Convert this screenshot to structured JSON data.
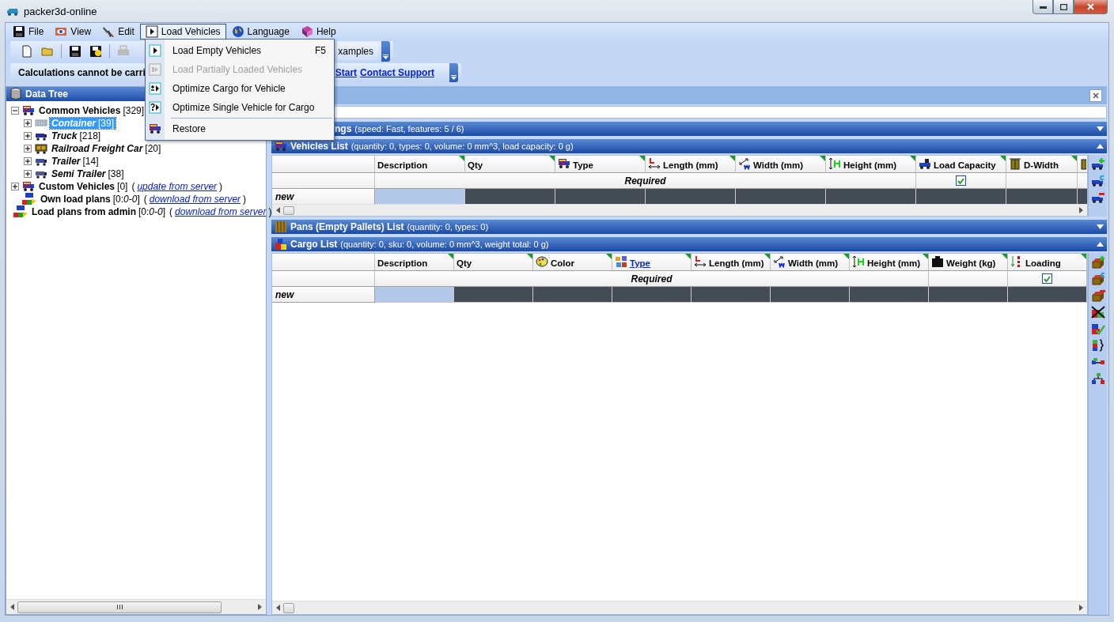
{
  "window": {
    "title": "packer3d-online"
  },
  "menu_bar": [
    {
      "label": "File",
      "selected": false
    },
    {
      "label": "View",
      "selected": false
    },
    {
      "label": "Edit",
      "selected": false
    },
    {
      "label": "Load Vehicles",
      "selected": true
    },
    {
      "label": "Language",
      "selected": false
    },
    {
      "label": "Help",
      "selected": false
    }
  ],
  "dropdown_menu": [
    {
      "kind": "item",
      "label": "Load Empty Vehicles",
      "shortcut": "F5",
      "disabled": false
    },
    {
      "kind": "item",
      "label": "Load Partially Loaded Vehicles",
      "disabled": true
    },
    {
      "kind": "item",
      "label": "Optimize Cargo for Vehicle",
      "disabled": false
    },
    {
      "kind": "item",
      "label": "Optimize Single Vehicle for Cargo",
      "disabled": false
    },
    {
      "kind": "separator"
    },
    {
      "kind": "item",
      "label": "Restore",
      "disabled": false
    }
  ],
  "toolbar": {
    "tab_label": "xamples"
  },
  "notice_bar": {
    "message": "Calculations cannot be carri",
    "links": [
      "Start",
      "Contact Support"
    ]
  },
  "data_tree": {
    "title": "Data Tree",
    "nodes": [
      {
        "label": "Common Vehicles",
        "count": "[329]",
        "expanded": true,
        "selected": false,
        "children": [
          {
            "label": "Container",
            "count": "[39]",
            "expanded": false,
            "selected": true
          },
          {
            "label": "Truck",
            "count": "[218]",
            "expanded": false,
            "selected": false
          },
          {
            "label": "Railroad Freight Car",
            "count": "[20]",
            "expanded": false,
            "selected": false
          },
          {
            "label": "Trailer",
            "count": "[14]",
            "expanded": false,
            "selected": false
          },
          {
            "label": "Semi Trailer",
            "count": "[38]",
            "expanded": false,
            "selected": false
          }
        ]
      },
      {
        "label": "Custom Vehicles",
        "count": "[0]",
        "link": "update from server",
        "link_brackets": [
          "(",
          ")"
        ],
        "expanded": false,
        "selected": false
      },
      {
        "label": "Own load plans",
        "count": "[0:*0-0*]",
        "link": "download from server",
        "link_brackets": [
          "(",
          ")"
        ],
        "selected": false
      },
      {
        "label": "Load plans from admin",
        "count": "[0:*0-0*]",
        "link": "download from server",
        "link_brackets": [
          "(",
          ")"
        ],
        "selected": false
      }
    ]
  },
  "settings_bar": {
    "title": "ngs",
    "details": "(speed: Fast, features: 5 / 6)",
    "expanded": false
  },
  "vehicles_list": {
    "title": "Vehicles List",
    "details": "(quantity: 0, types: 0, volume: 0 mm^3, load capacity: 0 g)",
    "expanded": true,
    "columns": [
      {
        "label": "Description",
        "kind": "required"
      },
      {
        "label": "Qty",
        "kind": "required"
      },
      {
        "label": "Type",
        "kind": "required"
      },
      {
        "label": "Length (mm)",
        "kind": "required"
      },
      {
        "label": "Width (mm)",
        "kind": "required"
      },
      {
        "label": "Height (mm)",
        "kind": "required"
      },
      {
        "label": "Load Capacity",
        "kind": "check",
        "checked": true
      },
      {
        "label": "D-Width",
        "kind": "plain"
      },
      {
        "kind": "plain"
      }
    ],
    "required_label": "Required",
    "new_row": {
      "label": "new",
      "cells": [
        {
          "selected": true
        },
        {
          "selected": false
        },
        {
          "selected": false
        },
        {
          "selected": false
        },
        {
          "selected": false
        },
        {
          "selected": false
        },
        {
          "selected": false
        },
        {
          "selected": false
        },
        {
          "selected": false
        }
      ]
    }
  },
  "pans_list": {
    "title": "Pans (Empty Pallets) List",
    "details": "(quantity: 0, types: 0)",
    "expanded": false
  },
  "cargo_list": {
    "title": "Cargo List",
    "details": "(quantity: 0, sku: 0, volume: 0 mm^3, weight total: 0 g)",
    "expanded": true,
    "columns": [
      {
        "label": "Description",
        "kind": "required"
      },
      {
        "label": "Qty",
        "kind": "required"
      },
      {
        "label": "Color",
        "kind": "required"
      },
      {
        "label": "Type",
        "kind": "required",
        "link": true
      },
      {
        "label": "Length (mm)",
        "kind": "required"
      },
      {
        "label": "Width (mm)",
        "kind": "required"
      },
      {
        "label": "Height (mm)",
        "kind": "required"
      },
      {
        "label": "Weight (kg)",
        "kind": "plain"
      },
      {
        "label": "Loading",
        "kind": "check",
        "checked": true
      }
    ],
    "required_label": "Required",
    "new_row": {
      "label": "new",
      "cells": [
        {
          "selected": true
        },
        {
          "selected": false
        },
        {
          "selected": false
        },
        {
          "selected": false
        },
        {
          "selected": false
        },
        {
          "selected": false
        },
        {
          "selected": false
        },
        {
          "selected": false
        },
        {
          "selected": false
        }
      ]
    }
  }
}
